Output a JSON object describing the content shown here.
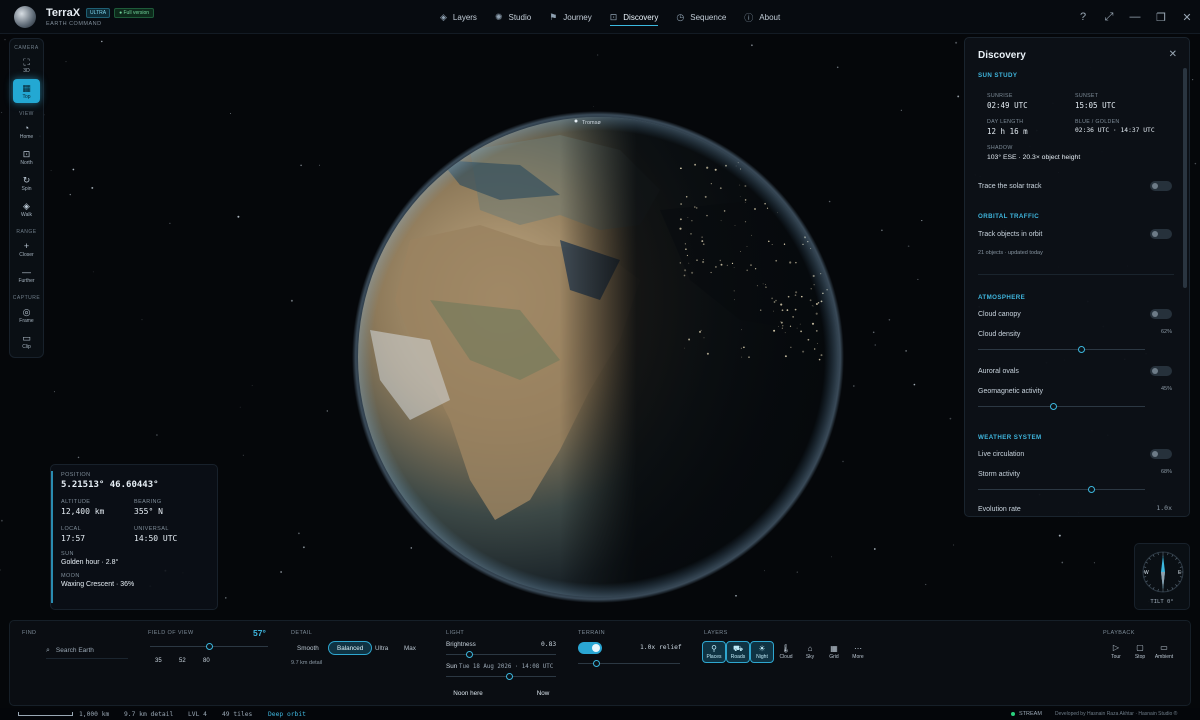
{
  "app": {
    "title": "TerraX",
    "subtitle": "EARTH COMMAND",
    "badge_ultra": "ULTRA",
    "badge_full": "Full version"
  },
  "nav": [
    {
      "label": "Layers",
      "icon": "layers-icon",
      "glyph": "◈"
    },
    {
      "label": "Studio",
      "icon": "studio-icon",
      "glyph": "✺"
    },
    {
      "label": "Journey",
      "icon": "flag-icon",
      "glyph": "⚑"
    },
    {
      "label": "Discovery",
      "icon": "discovery-icon",
      "glyph": "⊡",
      "active": true
    },
    {
      "label": "Sequence",
      "icon": "clock-icon",
      "glyph": "◷"
    },
    {
      "label": "About",
      "icon": "info-icon",
      "glyph": "ⓘ"
    }
  ],
  "top_actions": [
    {
      "name": "help-icon",
      "glyph": "?"
    },
    {
      "name": "expand-icon",
      "glyph": "⤢"
    },
    {
      "name": "minimize-icon",
      "glyph": "—"
    },
    {
      "name": "restore-icon",
      "glyph": "❐"
    },
    {
      "name": "close-icon",
      "glyph": "✕"
    }
  ],
  "toolbar": {
    "camera_label": "CAMERA",
    "view_label": "VIEW",
    "range_label": "RANGE",
    "capture_label": "CAPTURE",
    "tools": {
      "3d": "3D",
      "top": "Top",
      "home": "Home",
      "north": "North",
      "spin": "Spin",
      "walk": "Walk",
      "closer": "Closer",
      "further": "Further",
      "frame": "Frame",
      "clip": "Clip"
    }
  },
  "globe": {
    "label": "Tromsø"
  },
  "position": {
    "position_label": "POSITION",
    "position_value": "5.21513°  46.60443°",
    "altitude_label": "ALTITUDE",
    "altitude_value": "12,400 km",
    "bearing_label": "BEARING",
    "bearing_value": "355° N",
    "local_label": "LOCAL",
    "local_value": "17:57",
    "universal_label": "UNIVERSAL",
    "universal_value": "14:50 UTC",
    "sun_label": "SUN",
    "sun_value": "Golden hour · 2.8°",
    "moon_label": "MOON",
    "moon_value": "Waxing Crescent · 36%"
  },
  "discovery": {
    "title": "Discovery",
    "sun_study": "SUN STUDY",
    "sunrise_label": "SUNRISE",
    "sunrise_value": "02:49 UTC",
    "sunset_label": "SUNSET",
    "sunset_value": "15:05 UTC",
    "day_length_label": "DAY LENGTH",
    "day_length_value": "12 h 16 m",
    "blue_golden_label": "BLUE / GOLDEN",
    "blue_golden_value": "02:36 UTC · 14:37 UTC",
    "shadow_label": "SHADOW",
    "shadow_value": "103° ESE · 20.3× object height",
    "trace_solar": "Trace the solar track",
    "orbital_traffic": "ORBITAL TRAFFIC",
    "track_orbit": "Track objects in orbit",
    "orbit_count": "21 objects · updated today",
    "atmosphere": "ATMOSPHERE",
    "cloud_canopy": "Cloud canopy",
    "cloud_density": "Cloud density",
    "cloud_density_pct": "62%",
    "cloud_density_value": 0.62,
    "auroral_ovals": "Auroral ovals",
    "geomagnetic": "Geomagnetic activity",
    "geomagnetic_pct": "45%",
    "geomagnetic_value": 0.45,
    "weather_system": "WEATHER SYSTEM",
    "live_circulation": "Live circulation",
    "storm_activity": "Storm activity",
    "storm_pct": "68%",
    "storm_value": 0.68,
    "evolution_rate": "Evolution rate",
    "evolution_value": "1.0x"
  },
  "compass": {
    "tilt": "TILT 0°",
    "w": "W",
    "e": "E"
  },
  "bottom": {
    "find_label": "FIND",
    "search_placeholder": "Search Earth",
    "fov_label": "FIELD OF VIEW",
    "fov_value": "57°",
    "fov_level": 0.5,
    "fov_presets": [
      "35",
      "52",
      "80"
    ],
    "detail_label": "DETAIL",
    "detail_options": [
      "Smooth",
      "Balanced",
      "Ultra",
      "Max"
    ],
    "detail_selected": "Balanced",
    "detail_note": "9.7 km detail",
    "light_label": "LIGHT",
    "brightness_label": "Brightness",
    "brightness_value": "0.83",
    "brightness_level": 0.21,
    "sun_label": "Sun",
    "sun_date": "Tue 18 Aug 2026 · 14:08 UTC",
    "sun_level": 0.58,
    "noon_here": "Noon here",
    "now": "Now",
    "terrain_label": "TERRAIN",
    "terrain_relief": "1.0x relief",
    "terrain_level": 0.18,
    "layers_label": "LAYERS",
    "layers": [
      {
        "label": "Places",
        "icon": "places-icon",
        "glyph": "⚲",
        "active": true
      },
      {
        "label": "Roads",
        "icon": "roads-icon",
        "glyph": "⛟",
        "active": true
      },
      {
        "label": "Night",
        "icon": "night-icon",
        "glyph": "☀",
        "active": true
      },
      {
        "label": "Cloud",
        "icon": "thermometer-icon",
        "glyph": "🌡",
        "active": false
      },
      {
        "label": "Sky",
        "icon": "sky-icon",
        "glyph": "⌂",
        "active": false
      },
      {
        "label": "Grid",
        "icon": "grid-icon",
        "glyph": "▦",
        "active": false
      },
      {
        "label": "More",
        "icon": "more-icon",
        "glyph": "⋯",
        "active": false
      }
    ],
    "playback_label": "PLAYBACK",
    "playback": [
      {
        "label": "Tour",
        "icon": "play-icon",
        "glyph": "▷"
      },
      {
        "label": "Stop",
        "icon": "stop-icon",
        "glyph": "▢"
      },
      {
        "label": "Ambient",
        "icon": "monitor-icon",
        "glyph": "▭"
      }
    ]
  },
  "status": {
    "scale": "1,000 km",
    "detail": "9.7 km detail",
    "level": "LVL 4",
    "tiles": "49 tiles",
    "orbit": "Deep orbit",
    "stream": "STREAM",
    "credit": "Developed by Hasnain Raza Akhtar · Hasnain Studio ®"
  }
}
